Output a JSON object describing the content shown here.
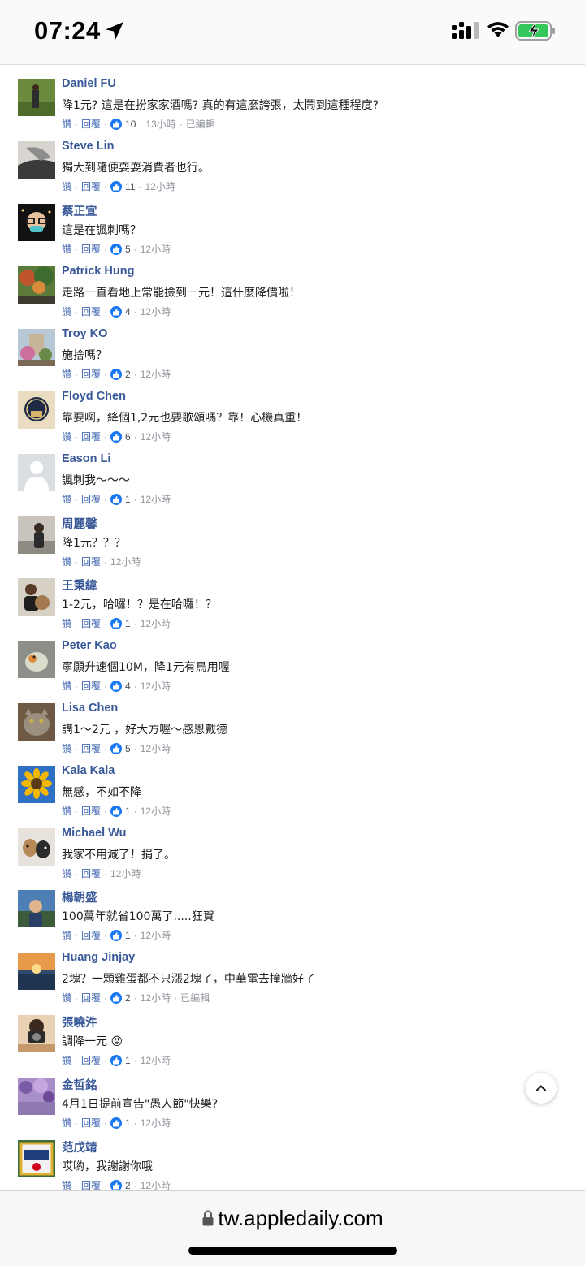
{
  "status_bar": {
    "time": "07:24"
  },
  "meta_labels": {
    "like": "讚",
    "reply": "回覆",
    "sep": "·"
  },
  "comments": [
    {
      "name": "Daniel FU",
      "text": "降1元? 這是在扮家家酒嗎? 真的有這麼誇張，太鬧到這種程度?",
      "likes": "10",
      "time": "13小時",
      "edited": "已編輯"
    },
    {
      "name": "Steve Lin",
      "text": "獨大到隨便耍耍消費者也行。",
      "likes": "11",
      "time": "12小時",
      "edited": ""
    },
    {
      "name": "蔡正宜",
      "text": "這是在諷刺嗎？",
      "likes": "5",
      "time": "12小時",
      "edited": ""
    },
    {
      "name": "Patrick Hung",
      "text": "走路一直看地上常能撿到一元！這什麼降價啦！",
      "likes": "4",
      "time": "12小時",
      "edited": ""
    },
    {
      "name": "Troy KO",
      "text": "施捨嗎？",
      "likes": "2",
      "time": "12小時",
      "edited": ""
    },
    {
      "name": "Floyd Chen",
      "text": "靠要啊，絳個1,2元也要歌頌嗎？靠！心機真重！",
      "likes": "6",
      "time": "12小時",
      "edited": ""
    },
    {
      "name": "Eason Li",
      "text": "諷刺我～～～",
      "likes": "1",
      "time": "12小時",
      "edited": ""
    },
    {
      "name": "周麗馨",
      "text": "降1元？？？",
      "likes": "",
      "time": "12小時",
      "edited": ""
    },
    {
      "name": "王秉緯",
      "text": "1-2元，哈囉！？是在哈囉！？",
      "likes": "1",
      "time": "12小時",
      "edited": ""
    },
    {
      "name": "Peter Kao",
      "text": "寧願升速個10M，降1元有鳥用喔",
      "likes": "4",
      "time": "12小時",
      "edited": ""
    },
    {
      "name": "Lisa Chen",
      "text": "講1～2元 ，好大方喔～感恩戴德",
      "likes": "5",
      "time": "12小時",
      "edited": ""
    },
    {
      "name": "Kala Kala",
      "text": "無感，不如不降",
      "likes": "1",
      "time": "12小時",
      "edited": ""
    },
    {
      "name": "Michael Wu",
      "text": "我家不用減了！捐了。",
      "likes": "",
      "time": "12小時",
      "edited": ""
    },
    {
      "name": "楊朝盛",
      "text": "100萬年就省100萬了.....狂賀",
      "likes": "1",
      "time": "12小時",
      "edited": ""
    },
    {
      "name": "Huang Jinjay",
      "text": "2塊？一顆雞蛋都不只漲2塊了，中華電去撞牆好了",
      "likes": "2",
      "time": "12小時",
      "edited": "已編輯"
    },
    {
      "name": "張曉汼",
      "text": "調降一元 😡",
      "likes": "1",
      "time": "12小時",
      "edited": ""
    },
    {
      "name": "金哲銘",
      "text": "4月1日提前宣告\"愚人節\"快樂?",
      "likes": "1",
      "time": "12小時",
      "edited": ""
    },
    {
      "name": "范戊靖",
      "text": "哎喲，我謝謝你哦",
      "likes": "2",
      "time": "12小時",
      "edited": ""
    }
  ],
  "address_bar": {
    "url": "tw.appledaily.com"
  },
  "colors": {
    "name": "#385898",
    "link": "#4267b2",
    "meta": "#90949c",
    "like": "#1877f2"
  },
  "icons": [
    "location-arrow-icon",
    "signal-icon",
    "wifi-icon",
    "battery-charging-icon",
    "thumbs-up-icon",
    "chevron-up-icon",
    "lock-icon"
  ]
}
